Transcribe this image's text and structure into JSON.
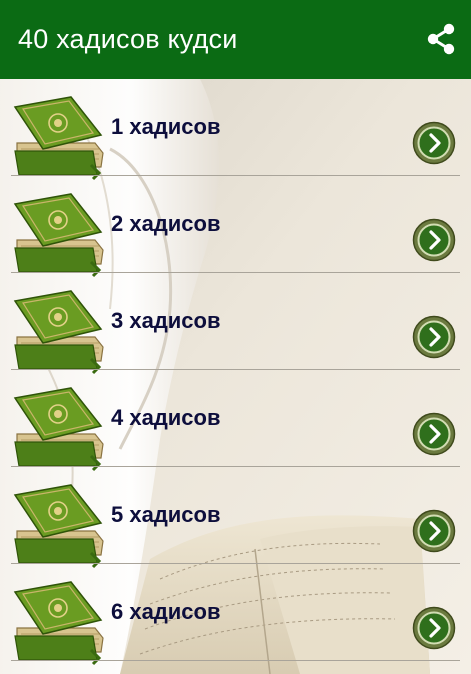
{
  "appbar": {
    "title": "40 хадисов кудси",
    "share_icon": "share-icon",
    "color": "#0b6b14"
  },
  "list": {
    "items": [
      {
        "label": "1 хадисов"
      },
      {
        "label": "2 хадисов"
      },
      {
        "label": "3 хадисов"
      },
      {
        "label": "4 хадисов"
      },
      {
        "label": "5 хадисов"
      },
      {
        "label": "6 хадисов"
      }
    ],
    "item_icon": "quran-book-icon",
    "action_icon": "chevron-right-circle-icon",
    "label_color": "#0d0e3c"
  }
}
